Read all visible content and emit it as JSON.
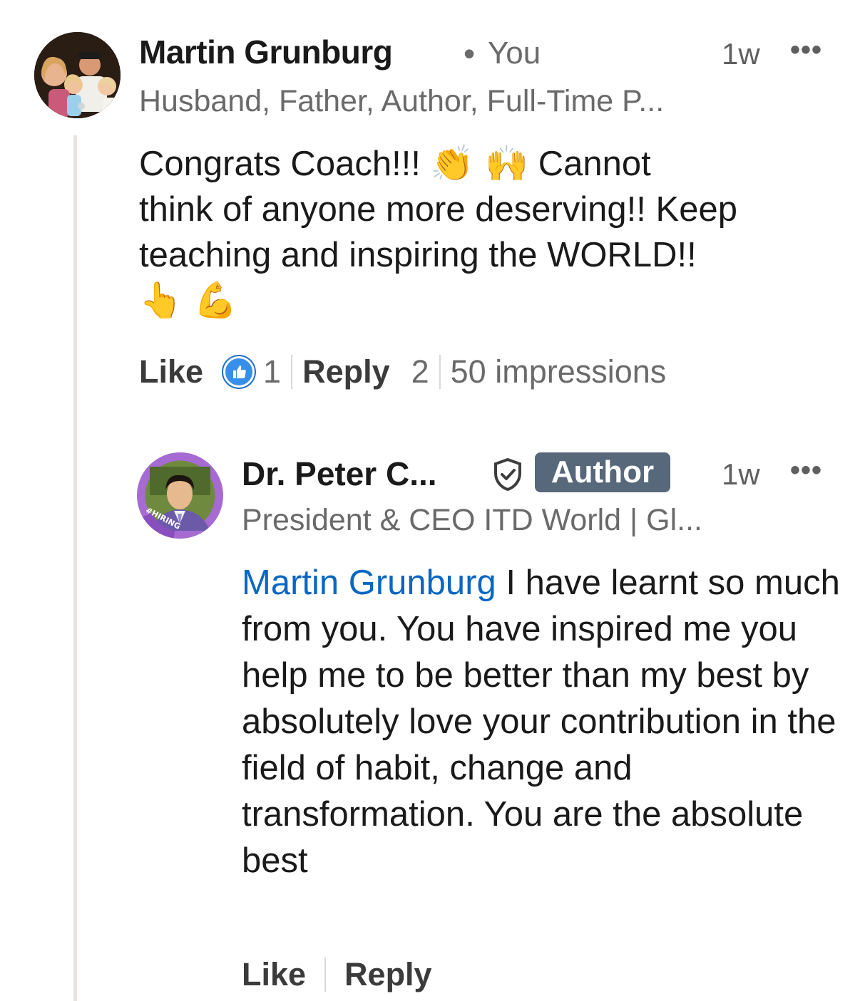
{
  "comment": {
    "author_name": "Martin Grunburg",
    "relation": "You",
    "time": "1w",
    "headline": "Husband, Father, Author, Full-Time P...",
    "body_line1_a": "Congrats Coach!!! ",
    "body_emoji1": "👏 🙌",
    "body_line1_b": "  Cannot",
    "body_rest": "think of anyone more deserving!! Keep teaching and inspiring the WORLD!!",
    "body_emoji2": "👆 💪",
    "actions": {
      "like_label": "Like",
      "like_count": "1",
      "reply_label": "Reply",
      "reply_count": "2",
      "impressions": "50 impressions"
    },
    "avatar_icon": "profile-photo-icon"
  },
  "reply": {
    "author_name": "Dr. Peter C...",
    "badge": "Author",
    "time": "1w",
    "headline": "President & CEO ITD World | Gl...",
    "mention": "Martin Grunburg",
    "body": " I have learnt so much from you. You have inspired me you help me to be better than my best by absolutely love your contribution in the field of habit, change and transformation. You are the absolute best",
    "avatar_frame_text": "#HIRING",
    "actions": {
      "like_label": "Like",
      "reply_label": "Reply"
    }
  },
  "colors": {
    "mention": "#0a66c2",
    "author_badge": "#56687a",
    "like_badge": "#378fe9",
    "hiring_frame": "#b27fd6"
  }
}
